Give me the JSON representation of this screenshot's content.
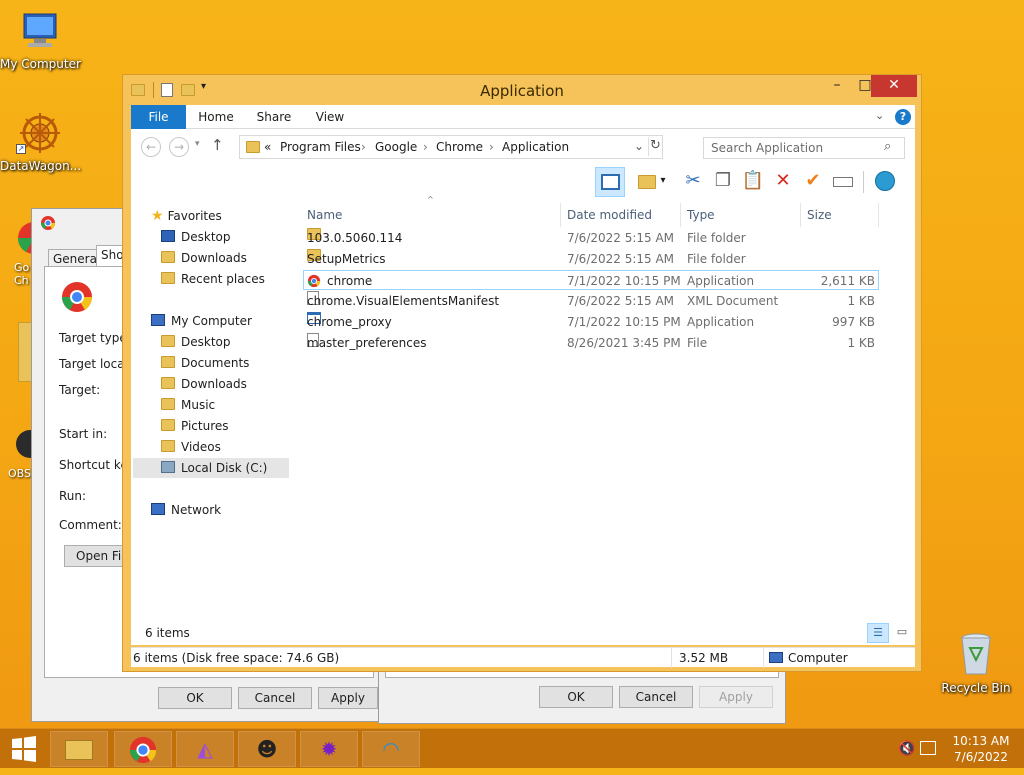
{
  "desktop": {
    "icons": [
      {
        "label": "My Computer"
      },
      {
        "label": "DataWagon..."
      },
      {
        "label": "Go\nCh"
      },
      {
        "label": "OBS"
      },
      {
        "label": "Recycle Bin"
      }
    ]
  },
  "props_dialog": {
    "tabs": [
      "General",
      "Shor"
    ],
    "rows": [
      "Target type:",
      "Target locatio",
      "Target:",
      "Start in:",
      "Shortcut key:",
      "Run:",
      "Comment:"
    ],
    "open_file_btn": "Open File",
    "ok": "OK",
    "cancel": "Cancel",
    "apply": "Apply"
  },
  "props_dialog2": {
    "ok": "OK",
    "cancel": "Cancel",
    "apply": "Apply"
  },
  "explorer": {
    "title": "Application",
    "ribbon_tabs": [
      "File",
      "Home",
      "Share",
      "View"
    ],
    "breadcrumb": [
      "«",
      "Program Files",
      "Google",
      "Chrome",
      "Application"
    ],
    "search_placeholder": "Search Application",
    "nav": {
      "favorites": "Favorites",
      "fav_items": [
        "Desktop",
        "Downloads",
        "Recent places"
      ],
      "computer": "My Computer",
      "comp_items": [
        "Desktop",
        "Documents",
        "Downloads",
        "Music",
        "Pictures",
        "Videos",
        "Local Disk (C:)"
      ],
      "network": "Network"
    },
    "columns": [
      "Name",
      "Date modified",
      "Type",
      "Size"
    ],
    "files": [
      {
        "name": "103.0.5060.114",
        "date": "7/6/2022 5:15 AM",
        "type": "File folder",
        "size": ""
      },
      {
        "name": "SetupMetrics",
        "date": "7/6/2022 5:15 AM",
        "type": "File folder",
        "size": ""
      },
      {
        "name": "chrome",
        "date": "7/1/2022 10:15 PM",
        "type": "Application",
        "size": "2,611 KB"
      },
      {
        "name": "chrome.VisualElementsManifest",
        "date": "7/6/2022 5:15 AM",
        "type": "XML Document",
        "size": "1 KB"
      },
      {
        "name": "chrome_proxy",
        "date": "7/1/2022 10:15 PM",
        "type": "Application",
        "size": "997 KB"
      },
      {
        "name": "master_preferences",
        "date": "8/26/2021 3:45 PM",
        "type": "File",
        "size": "1 KB"
      }
    ],
    "item_count": "6 items",
    "status_left": "6 items (Disk free space: 74.6 GB)",
    "status_size": "3.52 MB",
    "status_location": "Computer"
  },
  "taskbar": {
    "time": "10:13 AM",
    "date": "7/6/2022"
  },
  "colors": {
    "accent": "#1979ca",
    "desktop": "#f4a713",
    "title_bar": "#f6c35a",
    "close": "#c7372f"
  }
}
